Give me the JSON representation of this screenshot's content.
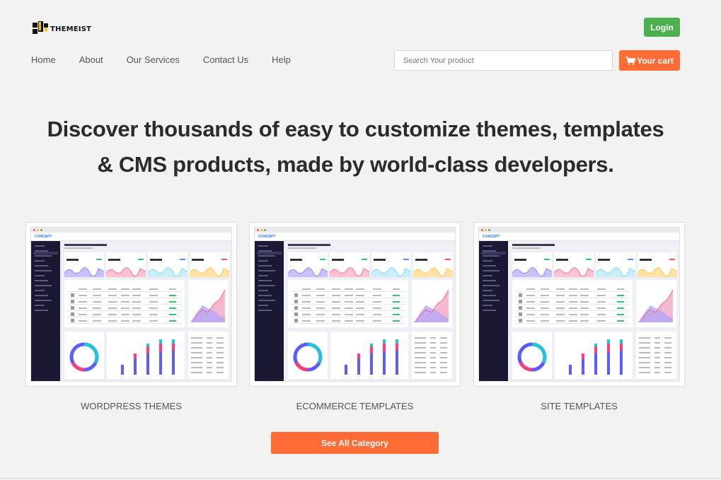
{
  "header": {
    "logo_text": "THEMEIST",
    "login_label": "Login",
    "search_placeholder": "Search Your product",
    "cart_label": "Your cart"
  },
  "nav": {
    "items": [
      {
        "label": "Home"
      },
      {
        "label": "About"
      },
      {
        "label": "Our Services"
      },
      {
        "label": "Contact Us"
      },
      {
        "label": "Help"
      }
    ]
  },
  "hero": {
    "line1": "Discover thousands of easy to customize themes, templates",
    "line2": "& CMS products, made by world-class developers."
  },
  "categories": [
    {
      "label": "WORDPRESS THEMES",
      "preview_brand": "CONCEPT"
    },
    {
      "label": "ECOMMERCE TEMPLATES",
      "preview_brand": "CONCEPT"
    },
    {
      "label": "SITE TEMPLATES",
      "preview_brand": "CONCEPT"
    }
  ],
  "see_all_label": "See All Category",
  "colors": {
    "accent_orange": "#ff6b35",
    "login_green": "#4caf50",
    "background": "#f2f2f2"
  }
}
